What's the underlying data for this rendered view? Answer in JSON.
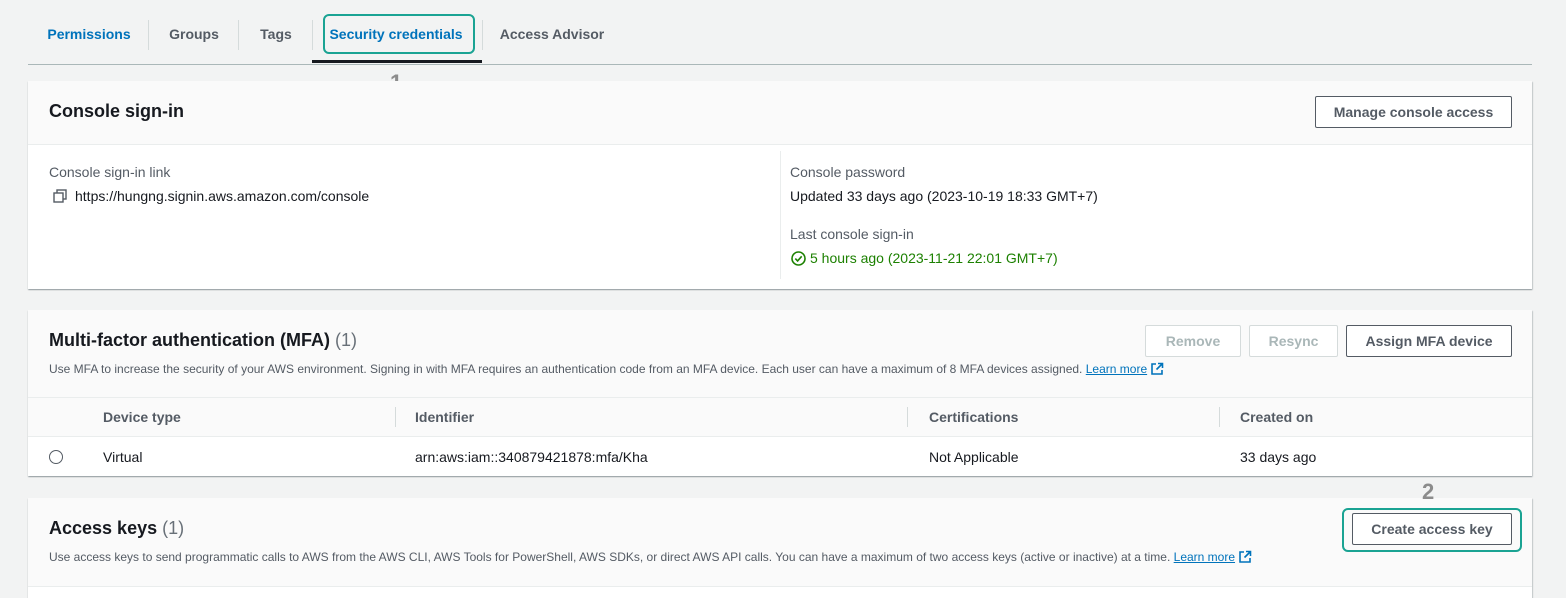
{
  "tabs": [
    {
      "label": "Permissions"
    },
    {
      "label": "Groups"
    },
    {
      "label": "Tags"
    },
    {
      "label": "Security credentials"
    },
    {
      "label": "Access Advisor"
    }
  ],
  "annotations": {
    "step1": "1",
    "step2": "2"
  },
  "console_signin": {
    "title": "Console sign-in",
    "manage_button": "Manage console access",
    "link_label": "Console sign-in link",
    "link_value": "https://hungng.signin.aws.amazon.com/console",
    "password_label": "Console password",
    "password_value": "Updated 33 days ago (2023-10-19 18:33 GMT+7)",
    "last_signin_label": "Last console sign-in",
    "last_signin_value": "5 hours ago (2023-11-21 22:01 GMT+7)"
  },
  "mfa": {
    "title": "Multi-factor authentication (MFA)",
    "count": "(1)",
    "description": "Use MFA to increase the security of your AWS environment. Signing in with MFA requires an authentication code from an MFA device. Each user can have a maximum of 8 MFA devices assigned.",
    "learn_more": "Learn more",
    "remove_button": "Remove",
    "resync_button": "Resync",
    "assign_button": "Assign MFA device",
    "columns": [
      "Device type",
      "Identifier",
      "Certifications",
      "Created on"
    ],
    "rows": [
      {
        "device_type": "Virtual",
        "identifier": "arn:aws:iam::340879421878:mfa/Kha",
        "certifications": "Not Applicable",
        "created_on": "33 days ago"
      }
    ]
  },
  "access_keys": {
    "title": "Access keys",
    "count": "(1)",
    "description": "Use access keys to send programmatic calls to AWS from the AWS CLI, AWS Tools for PowerShell, AWS SDKs, or direct AWS API calls. You can have a maximum of two access keys (active or inactive) at a time.",
    "learn_more": "Learn more",
    "create_button": "Create access key"
  },
  "colors": {
    "link": "#0073bb",
    "success": "#1d8102",
    "highlight": "#1aa393"
  }
}
